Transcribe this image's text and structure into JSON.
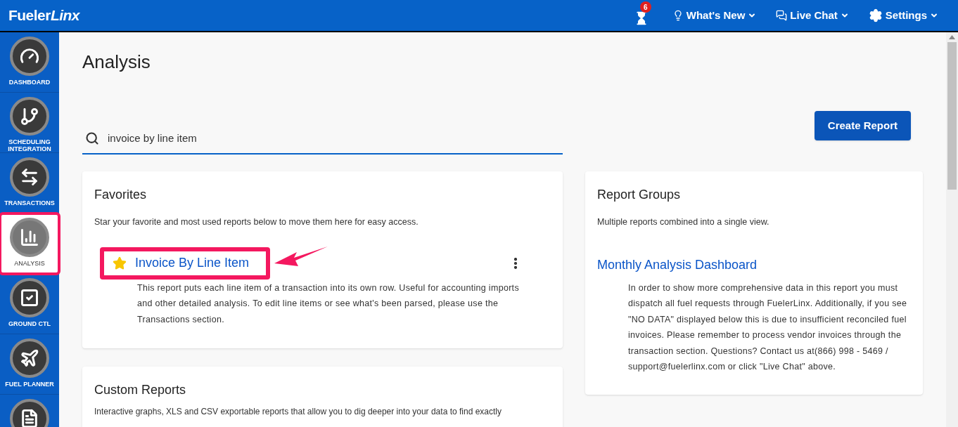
{
  "header": {
    "logo": {
      "plain": "Fueler",
      "italic": "Linx"
    },
    "notifications": {
      "count": "6"
    },
    "menus": [
      {
        "kind": "bulb",
        "label": "What's New"
      },
      {
        "kind": "chat",
        "label": "Live Chat"
      },
      {
        "kind": "gear",
        "label": "Settings"
      }
    ]
  },
  "sidebar": {
    "items": [
      {
        "kind": "gauge",
        "label": "DASHBOARD",
        "selected": false,
        "annotated": false
      },
      {
        "kind": "branch",
        "label": "SCHEDULING INTEGRATION",
        "selected": false,
        "annotated": false
      },
      {
        "kind": "swap",
        "label": "TRANSACTIONS",
        "selected": false,
        "annotated": false
      },
      {
        "kind": "chart",
        "label": "ANALYSIS",
        "selected": true,
        "annotated": true
      },
      {
        "kind": "check",
        "label": "GROUND CTL",
        "selected": false,
        "annotated": false
      },
      {
        "kind": "plane",
        "label": "FUEL PLANNER",
        "selected": false,
        "annotated": false
      },
      {
        "kind": "document",
        "selected": false,
        "annotated": false
      }
    ]
  },
  "page": {
    "title": "Analysis",
    "search": {
      "value": "invoice by line item"
    },
    "create_button": "Create Report"
  },
  "favorites": {
    "title": "Favorites",
    "description": "Star your favorite and most used reports below to move them here for easy access.",
    "reports": [
      {
        "name": "Invoice By Line Item",
        "starred": true,
        "annotated": true,
        "description": "This report puts each line item of a transaction into its own row. Useful for accounting imports and other detailed analysis. To edit line items or see what's been parsed, please use the Transactions section."
      }
    ]
  },
  "custom_reports": {
    "title": "Custom Reports",
    "description": "Interactive graphs, XLS and CSV exportable reports that allow you to dig deeper into your data to find exactly"
  },
  "report_groups": {
    "title": "Report Groups",
    "description": "Multiple reports combined into a single view.",
    "groups": [
      {
        "name": "Monthly Analysis Dashboard",
        "description": "In order to show more comprehensive data in this report you must dispatch all fuel requests through FuelerLinx. Additionally, if you see \"NO DATA\" displayed below this is due to insufficient reconciled fuel invoices. Please remember to process vendor invoices through the transaction section. Questions? Contact us at(866) 998 - 5469 / support@fuelerlinx.com or click \"Live Chat\" above."
      }
    ]
  }
}
